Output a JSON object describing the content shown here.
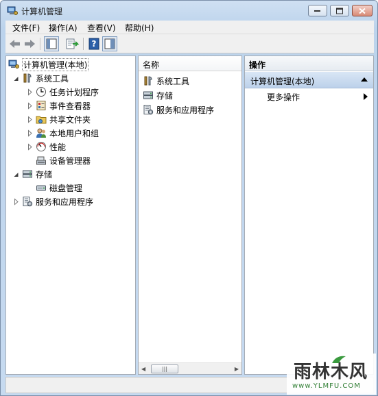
{
  "window": {
    "title": "计算机管理"
  },
  "menu": [
    "文件(F)",
    "操作(A)",
    "查看(V)",
    "帮助(H)"
  ],
  "tree": [
    {
      "label": "计算机管理(本地)",
      "icon": "computer-management-icon",
      "expander": "none",
      "level": 0,
      "selected": true
    },
    {
      "label": "系统工具",
      "icon": "system-tools-icon",
      "expander": "expanded",
      "level": 1
    },
    {
      "label": "任务计划程序",
      "icon": "task-scheduler-icon",
      "expander": "collapsed",
      "level": 2
    },
    {
      "label": "事件查看器",
      "icon": "event-viewer-icon",
      "expander": "collapsed",
      "level": 2
    },
    {
      "label": "共享文件夹",
      "icon": "shared-folders-icon",
      "expander": "collapsed",
      "level": 2
    },
    {
      "label": "本地用户和组",
      "icon": "local-users-icon",
      "expander": "collapsed",
      "level": 2
    },
    {
      "label": "性能",
      "icon": "performance-icon",
      "expander": "collapsed",
      "level": 2
    },
    {
      "label": "设备管理器",
      "icon": "device-manager-icon",
      "expander": "none",
      "level": 2
    },
    {
      "label": "存储",
      "icon": "storage-icon",
      "expander": "expanded",
      "level": 1
    },
    {
      "label": "磁盘管理",
      "icon": "disk-management-icon",
      "expander": "none",
      "level": 2
    },
    {
      "label": "服务和应用程序",
      "icon": "services-apps-icon",
      "expander": "collapsed",
      "level": 1
    }
  ],
  "list": {
    "header": "名称",
    "items": [
      {
        "label": "系统工具",
        "icon": "system-tools-icon"
      },
      {
        "label": "存储",
        "icon": "storage-icon"
      },
      {
        "label": "服务和应用程序",
        "icon": "services-apps-icon"
      }
    ],
    "scroll_thumb": "|||"
  },
  "actions": {
    "header": "操作",
    "section": "计算机管理(本地)",
    "more": "更多操作"
  },
  "watermark": {
    "main": "雨林木风",
    "sub": "www.YLMFU.COM"
  }
}
